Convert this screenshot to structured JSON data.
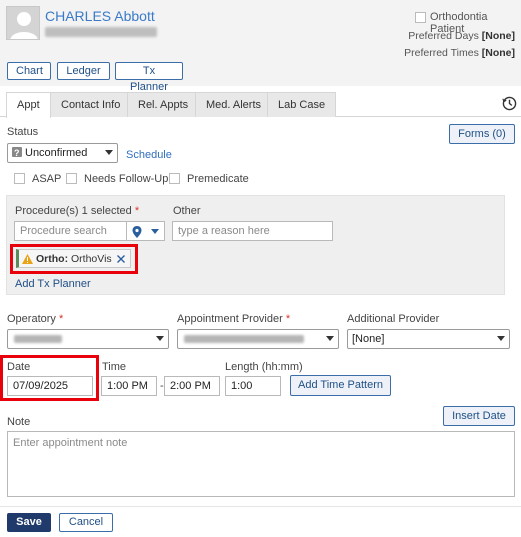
{
  "patient": {
    "name": "CHARLES Abbott",
    "orthodontia_label": "Orthodontia Patient",
    "preferred_days_label": "Preferred Days",
    "preferred_days_value": "[None]",
    "preferred_times_label": "Preferred Times",
    "preferred_times_value": "[None]"
  },
  "header_buttons": {
    "chart": "Chart",
    "ledger": "Ledger",
    "tx_planner": "Tx Planner"
  },
  "tabs": [
    {
      "label": "Appt",
      "active": true
    },
    {
      "label": "Contact Info"
    },
    {
      "label": "Rel. Appts"
    },
    {
      "label": "Med. Alerts"
    },
    {
      "label": "Lab Case"
    }
  ],
  "status": {
    "label": "Status",
    "value": "Unconfirmed",
    "schedule_link": "Schedule",
    "forms_button": "Forms (0)"
  },
  "flags": {
    "asap": "ASAP",
    "follow_up": "Needs Follow-Up",
    "premedicate": "Premedicate"
  },
  "procedures": {
    "label": "Procedure(s)",
    "count_text": "1 selected",
    "search_placeholder": "Procedure search",
    "other_label": "Other",
    "other_placeholder": "type a reason here",
    "chip_label": "Ortho:",
    "chip_value": "OrthoVis",
    "add_tx_planner": "Add Tx Planner"
  },
  "providers": {
    "operatory_label": "Operatory",
    "appointment_provider_label": "Appointment Provider",
    "additional_provider_label": "Additional Provider",
    "additional_provider_value": "[None]"
  },
  "timing": {
    "date_label": "Date",
    "date_value": "07/09/2025",
    "time_label": "Time",
    "start_time": "1:00 PM",
    "separator": "-",
    "end_time": "2:00 PM",
    "length_label": "Length (hh:mm)",
    "length_value": "1:00",
    "add_time_pattern": "Add Time Pattern"
  },
  "note": {
    "label": "Note",
    "insert_date": "Insert Date",
    "placeholder": "Enter appointment note"
  },
  "footer": {
    "save": "Save",
    "cancel": "Cancel"
  },
  "colors": {
    "link": "#2f6fbf",
    "primary": "#1f3a6b",
    "highlight": "#e8000b",
    "warning": "#e8a317"
  }
}
